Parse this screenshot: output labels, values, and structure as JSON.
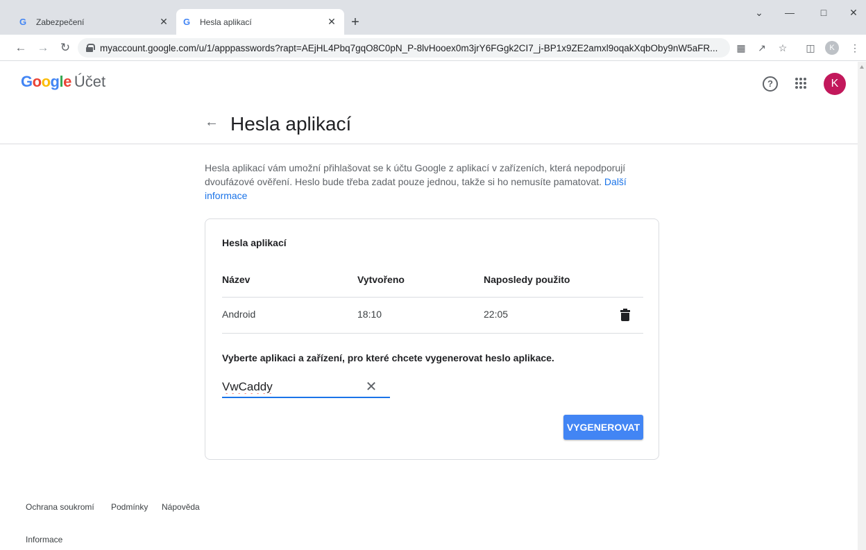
{
  "browser": {
    "tabs": [
      {
        "label": "Zabezpečení",
        "favicon": "G",
        "close": "✕"
      },
      {
        "label": "Hesla aplikací",
        "favicon": "G",
        "close": "✕"
      }
    ],
    "new_tab": "+",
    "url": "myaccount.google.com/u/1/apppasswords?rapt=AEjHL4Pbq7gqO8C0pN_P-8lvHooex0m3jrY6FGgk2CI7_j-BP1x9ZE2amxl9oqakXqbOby9nW5aFR...",
    "profile_initial": "K"
  },
  "header": {
    "logo_letters": [
      "G",
      "o",
      "o",
      "g",
      "l",
      "e"
    ],
    "product": "Účet",
    "help": "?",
    "avatar_initial": "K"
  },
  "page": {
    "title": "Hesla aplikací",
    "back": "←",
    "intro_text": "Hesla aplikací vám umožní přihlašovat se k účtu Google z aplikací v zařízeních, která nepodporují dvoufázové ověření. Heslo bude třeba zadat pouze jednou, takže si ho nemusíte pamatovat. ",
    "intro_link": "Další informace"
  },
  "card": {
    "title": "Hesla aplikací",
    "columns": [
      "Název",
      "Vytvořeno",
      "Naposledy použito"
    ],
    "rows": [
      {
        "name": "Android",
        "created": "18:10",
        "last_used": "22:05"
      }
    ],
    "instruction": "Vyberte aplikaci a zařízení, pro které chcete vygenerovat heslo aplikace.",
    "input_value": "VwCaddy",
    "clear": "✕",
    "button": "VYGENEROVAT"
  },
  "footer": {
    "links": [
      "Ochrana soukromí",
      "Podmínky",
      "Nápověda",
      "Informace"
    ]
  },
  "colors": {
    "accent": "#1a73e8",
    "button": "#4285f4",
    "avatar": "#c2185b"
  }
}
